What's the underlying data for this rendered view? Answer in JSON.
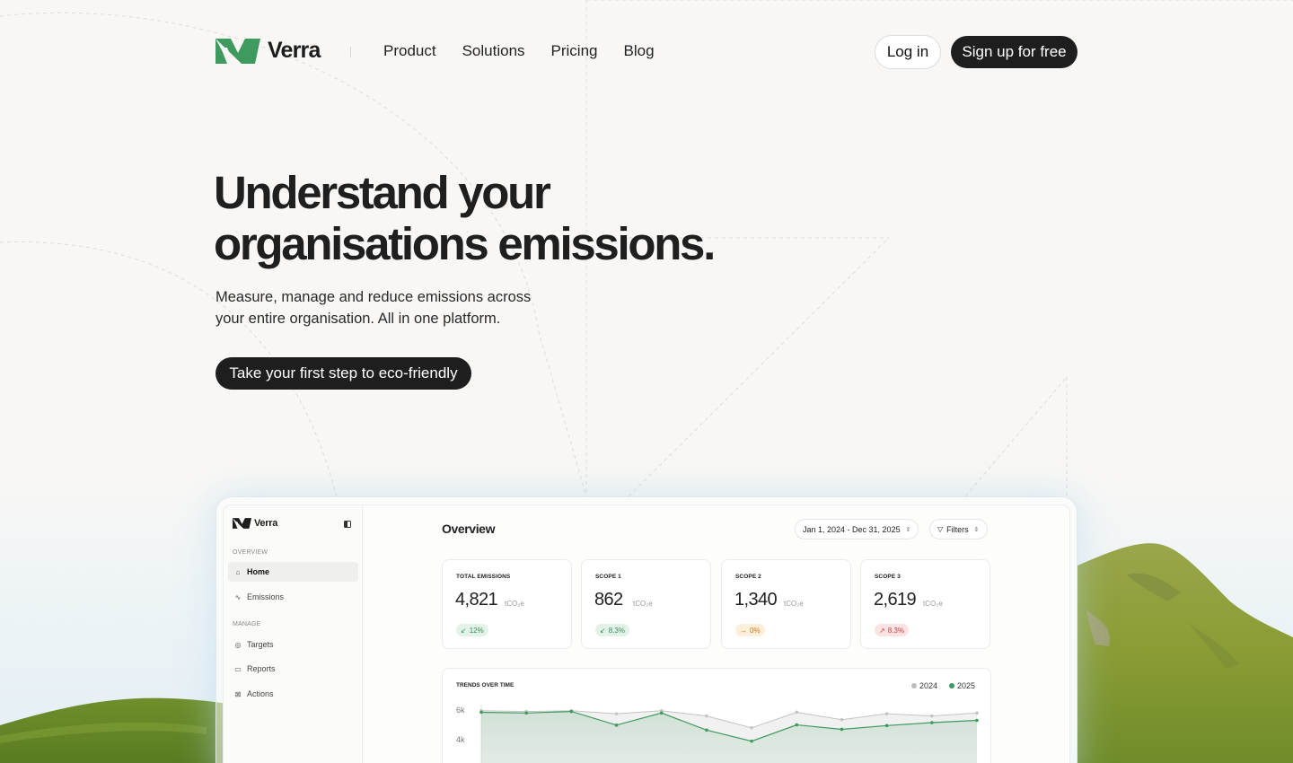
{
  "brand": {
    "name": "Verra",
    "color": "#3e9a5f"
  },
  "nav": {
    "links": [
      "Product",
      "Solutions",
      "Pricing",
      "Blog"
    ],
    "login_label": "Log in",
    "signup_label": "Sign up for free"
  },
  "hero": {
    "title_line1": "Understand your",
    "title_line2": "organisations emissions.",
    "subtitle_line1": "Measure, manage and reduce emissions across",
    "subtitle_line2": "your entire organisation. All in one platform.",
    "cta_label": "Take your first step to eco-friendly"
  },
  "app": {
    "brand": "Verra",
    "sidebar": {
      "overview_heading": "OVERVIEW",
      "manage_heading": "MANAGE",
      "items": [
        {
          "label": "Home",
          "icon": "home-icon",
          "active": true
        },
        {
          "label": "Emissions",
          "icon": "activity-icon",
          "active": false
        },
        {
          "label": "Targets",
          "icon": "target-icon",
          "active": false
        },
        {
          "label": "Reports",
          "icon": "folder-icon",
          "active": false
        },
        {
          "label": "Actions",
          "icon": "grid-icon",
          "active": false
        }
      ]
    },
    "overview_title": "Overview",
    "date_range": "Jan 1, 2024 - Dec 31, 2025",
    "filters_label": "Filters",
    "unit": "tCO₂e",
    "cards": [
      {
        "label": "TOTAL EMISSIONS",
        "value": "4,821",
        "change": "12%",
        "trend": "down",
        "arrow": "↙"
      },
      {
        "label": "SCOPE 1",
        "value": "862",
        "change": "8.3%",
        "trend": "down",
        "arrow": "↙"
      },
      {
        "label": "SCOPE 2",
        "value": "1,340",
        "change": "0%",
        "trend": "flat",
        "arrow": "→"
      },
      {
        "label": "SCOPE 3",
        "value": "2,619",
        "change": "8.3%",
        "trend": "up",
        "arrow": "↗"
      }
    ],
    "trend": {
      "title": "TRENDS OVER TIME",
      "y_ticks": [
        "6k",
        "4k"
      ],
      "legend": [
        {
          "label": "2024",
          "color": "#bdbdbd"
        },
        {
          "label": "2025",
          "color": "#3e9a5f"
        }
      ]
    }
  },
  "chart_data": {
    "type": "area",
    "title": "TRENDS OVER TIME",
    "y_ticks": [
      6000,
      4000
    ],
    "series": [
      {
        "name": "2024",
        "values": [
          5950,
          5900,
          5950,
          5750,
          5950,
          5600,
          4800,
          5850,
          5350,
          5750,
          5600,
          5800
        ],
        "color": "#c4c4c4"
      },
      {
        "name": "2025",
        "values": [
          5850,
          5800,
          5900,
          4980,
          5800,
          4650,
          3900,
          5000,
          4700,
          4950,
          5150,
          5300
        ],
        "color": "#3e9a5f"
      }
    ]
  }
}
